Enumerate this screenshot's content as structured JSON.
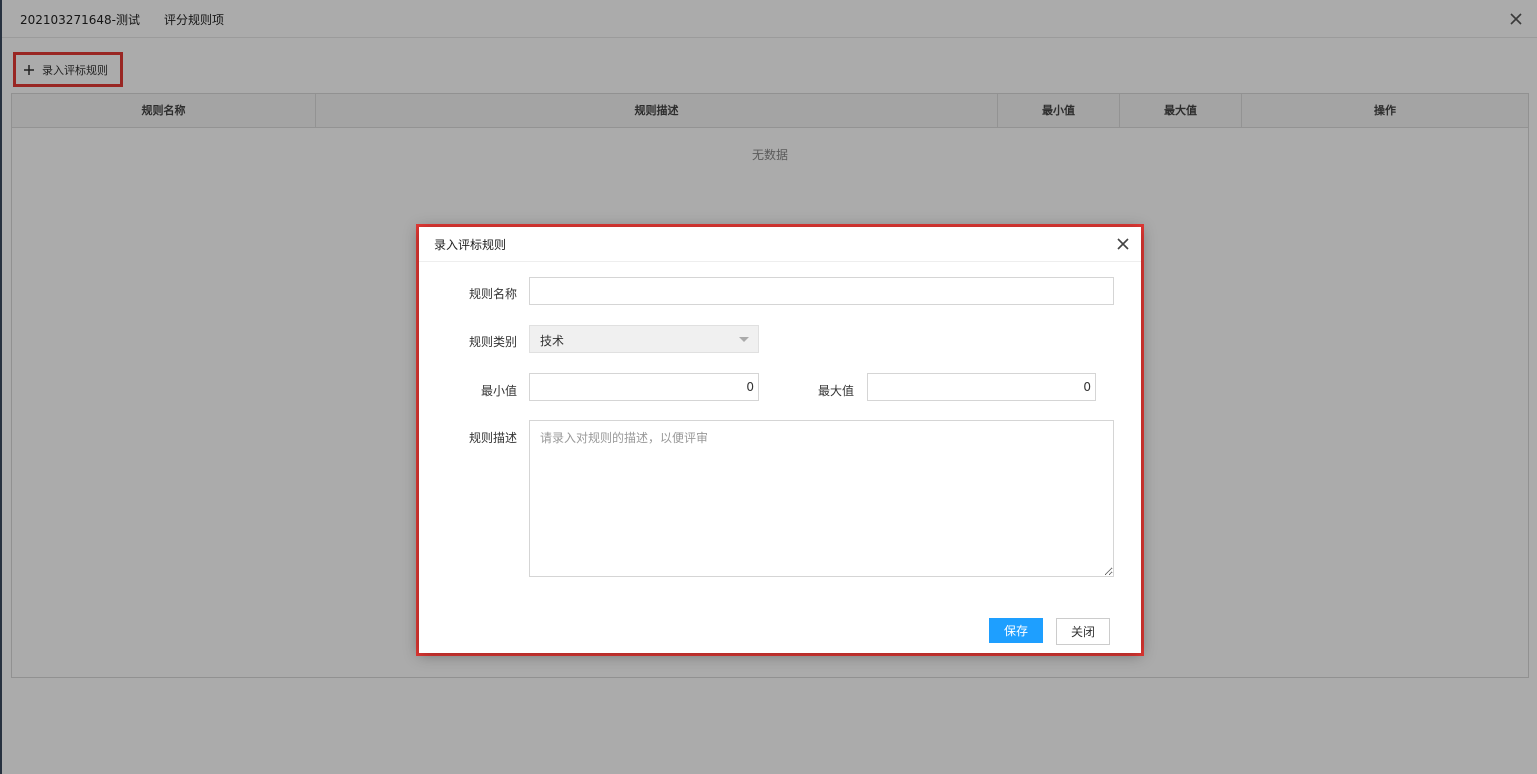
{
  "header": {
    "crumb_project": "202103271648-测试",
    "crumb_section": "评分规则项",
    "close_icon": "close-icon"
  },
  "toolbar": {
    "add_label": "录入评标规则",
    "add_icon": "plus-icon"
  },
  "table": {
    "columns": [
      "规则名称",
      "规则描述",
      "最小值",
      "最大值",
      "操作"
    ],
    "empty_text": "无数据"
  },
  "dialog": {
    "title": "录入评标规则",
    "close_icon": "close-icon",
    "fields": {
      "name_label": "规则名称",
      "name_value": "",
      "category_label": "规则类别",
      "category_value": "技术",
      "min_label": "最小值",
      "min_value": "0",
      "max_label": "最大值",
      "max_value": "0",
      "desc_label": "规则描述",
      "desc_placeholder": "请录入对规则的描述，以便评审",
      "desc_value": ""
    },
    "buttons": {
      "save": "保存",
      "close": "关闭"
    }
  },
  "colors": {
    "primary": "#1e9fff",
    "highlight": "#e53935",
    "overlay": "rgba(0,0,0,0.33)"
  }
}
